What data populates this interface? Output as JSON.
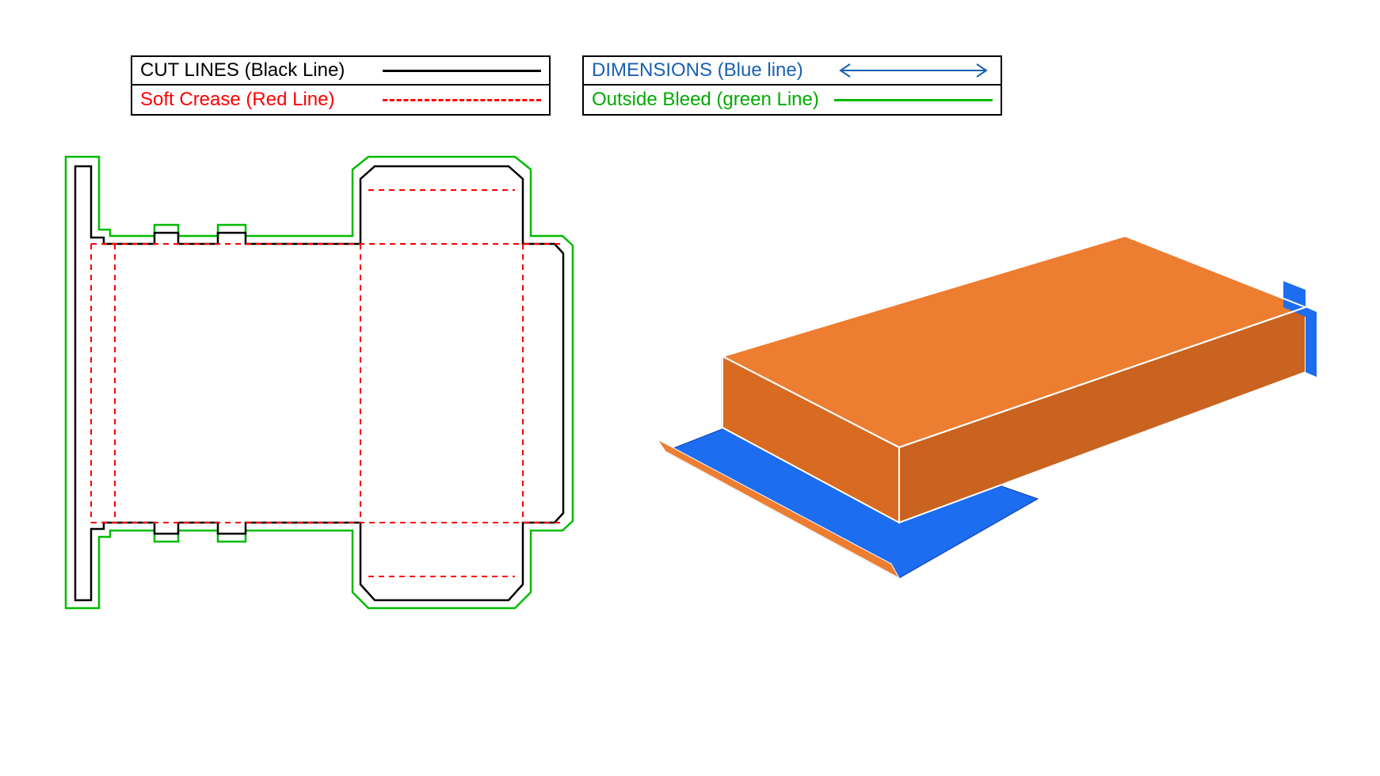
{
  "legend": {
    "left": [
      {
        "label": "CUT LINES (Black Line)",
        "color": "#000000",
        "style": "solid"
      },
      {
        "label": "Soft Crease (Red Line)",
        "color": "#ff0000",
        "style": "dashed"
      }
    ],
    "right": [
      {
        "label": "DIMENSIONS (Blue line)",
        "color": "#1a5fb4",
        "style": "arrow"
      },
      {
        "label": "Outside Bleed (green Line)",
        "color": "#00aa00",
        "style": "solid"
      }
    ]
  },
  "dieline": {
    "description": "Flat packaging die-cut template for a tuck-end box",
    "line_types": {
      "cut": "black solid",
      "crease": "red dashed",
      "bleed": "green solid outline offset outward"
    }
  },
  "render3d": {
    "description": "Isometric-style 3D preview of folded box",
    "outer_color": "#ed7d31",
    "inner_color": "#1c6df0",
    "edge_color": "#ffffff",
    "state": "partially open, front tuck flap extended"
  }
}
